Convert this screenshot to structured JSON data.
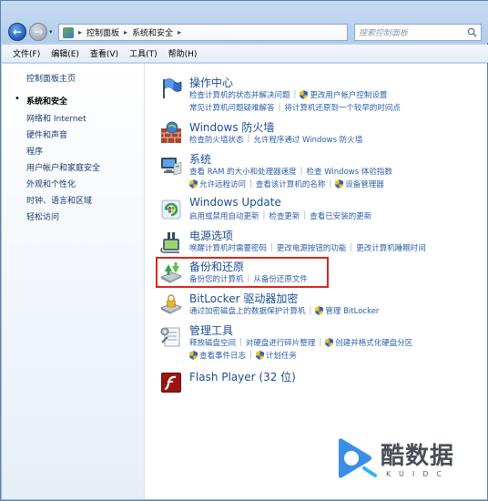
{
  "address": {
    "crumbs": [
      "控制面板",
      "系统和安全"
    ],
    "search_placeholder": "搜索控制面板"
  },
  "menu": [
    "文件(F)",
    "编辑(E)",
    "查看(V)",
    "工具(T)",
    "帮助(H)"
  ],
  "sidebar": {
    "home": "控制面板主页",
    "items": [
      "系统和安全",
      "网络和 Internet",
      "硬件和声音",
      "程序",
      "用户帐户和家庭安全",
      "外观和个性化",
      "时钟、语言和区域",
      "轻松访问"
    ]
  },
  "categories": {
    "action_center": {
      "title": "操作中心",
      "line1": [
        "检查计算机的状态并解决问题",
        "更改用户帐户控制设置"
      ],
      "line2": [
        "常见计算机问题疑难解答",
        "将计算机还原到一个较早的时间点"
      ]
    },
    "firewall": {
      "title": "Windows 防火墙",
      "line1": [
        "检查防火墙状态",
        "允许程序通过 Windows 防火墙"
      ]
    },
    "system": {
      "title": "系统",
      "line1": [
        "查看 RAM 的大小和处理器速度",
        "检查 Windows 体验指数"
      ],
      "line2": [
        "允许远程访问",
        "查看该计算机的名称",
        "设备管理器"
      ]
    },
    "update": {
      "title": "Windows Update",
      "line1": [
        "启用或禁用自动更新",
        "检查更新",
        "查看已安装的更新"
      ]
    },
    "power": {
      "title": "电源选项",
      "line1": [
        "唤醒计算机时需要密码",
        "更改电源按钮的功能",
        "更改计算机睡眠时间"
      ]
    },
    "backup": {
      "title": "备份和还原",
      "line1": [
        "备份您的计算机",
        "从备份还原文件"
      ]
    },
    "bitlocker": {
      "title": "BitLocker 驱动器加密",
      "line1": [
        "通过加密磁盘上的数据保护计算机",
        "管理 BitLocker"
      ]
    },
    "admin_tools": {
      "title": "管理工具",
      "line1": [
        "释放磁盘空间",
        "对硬盘进行碎片整理",
        "创建并格式化硬盘分区"
      ],
      "line2": [
        "查看事件日志",
        "计划任务"
      ]
    },
    "flash": {
      "title": "Flash Player (32 位)"
    }
  },
  "watermark": {
    "text": "酷数据",
    "sub": "KUIDC"
  },
  "colors": {
    "link": "#2a5da8",
    "title": "#1c4d91",
    "highlight": "#d9261c"
  }
}
